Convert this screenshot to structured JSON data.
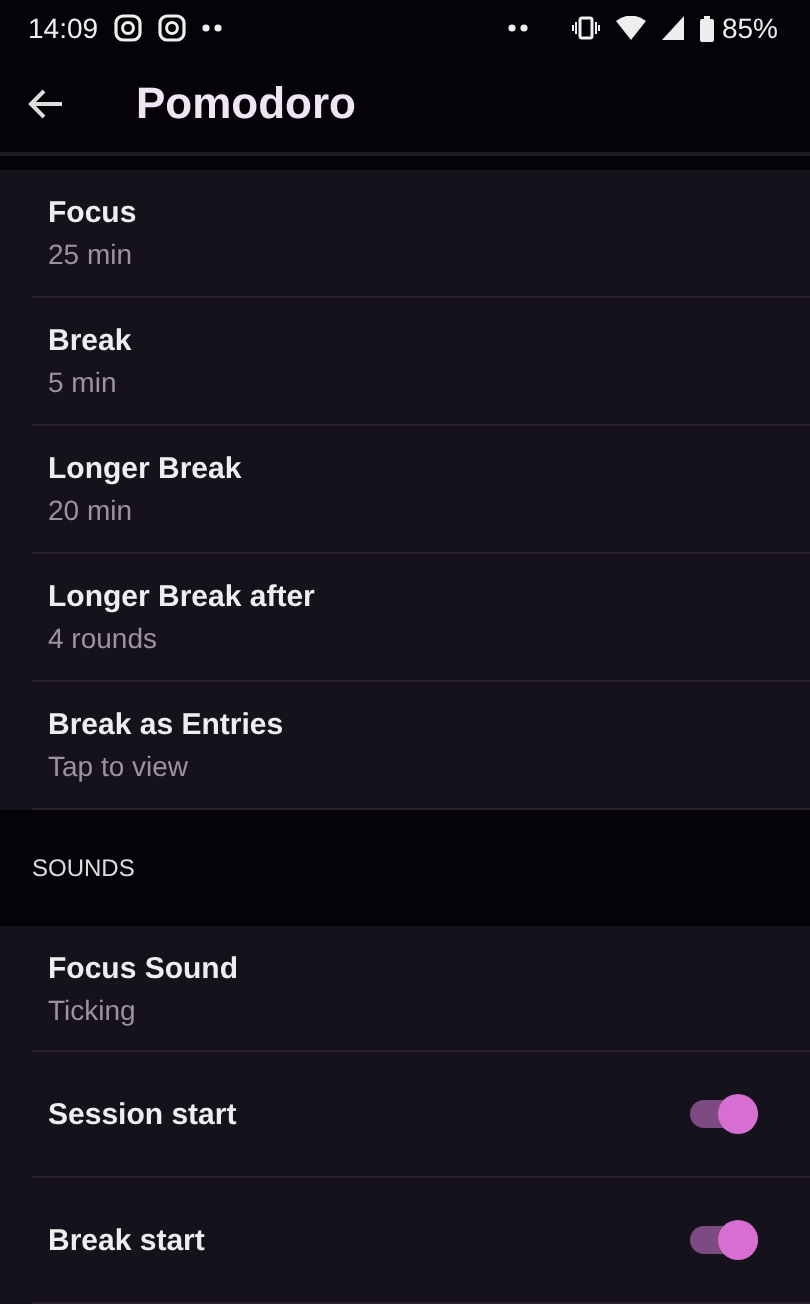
{
  "status_bar": {
    "time": "14:09",
    "battery": "85%"
  },
  "app_bar": {
    "title": "Pomodoro"
  },
  "timer_settings": [
    {
      "kind": "value",
      "title": "Focus",
      "value": "25 min"
    },
    {
      "kind": "value",
      "title": "Break",
      "value": "5 min"
    },
    {
      "kind": "value",
      "title": "Longer Break",
      "value": "20 min"
    },
    {
      "kind": "value",
      "title": "Longer Break after",
      "value": "4 rounds"
    },
    {
      "kind": "value",
      "title": "Break as Entries",
      "value": "Tap to view"
    }
  ],
  "sounds": {
    "header": "SOUNDS",
    "items": [
      {
        "kind": "value",
        "title": "Focus Sound",
        "value": "Ticking"
      },
      {
        "kind": "toggle",
        "title": "Session start",
        "on": true
      },
      {
        "kind": "toggle",
        "title": "Break start",
        "on": true
      }
    ]
  }
}
